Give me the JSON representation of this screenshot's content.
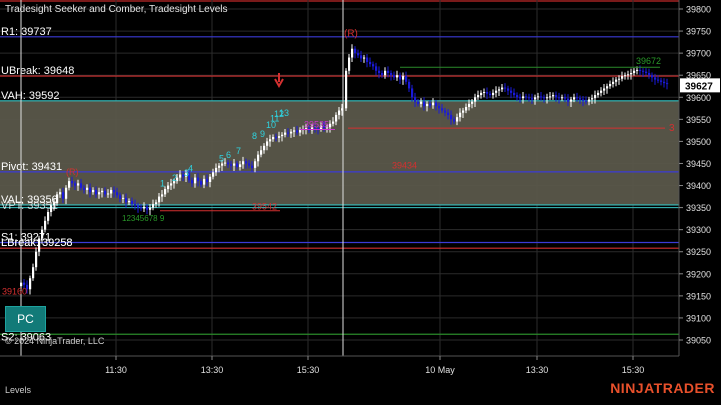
{
  "window": {
    "title": "Tradesight Seeker and Comber, Tradesight Levels",
    "copyright": "© 2024 NinjaTrader, LLC",
    "tab_label": "Levels",
    "brand": "NINJATRADER",
    "pc_button": "PC"
  },
  "price_axis": {
    "min": 39050,
    "max": 39800,
    "ticks": [
      39800,
      39750,
      39700,
      39650,
      39600,
      39550,
      39500,
      39450,
      39400,
      39350,
      39300,
      39250,
      39200,
      39150,
      39100,
      39050
    ],
    "current_price": 39627
  },
  "time_axis": {
    "labels": [
      {
        "label": "11:30"
      },
      {
        "label": "13:30"
      },
      {
        "label": "15:30"
      },
      {
        "label": "10 May"
      },
      {
        "label": "13:30"
      },
      {
        "label": "15:30"
      }
    ]
  },
  "levels": [
    {
      "label": "R1: 39737",
      "price": 39737,
      "color": "#3b3bd6"
    },
    {
      "label": "UBreak: 39648",
      "price": 39648,
      "color": "#d43030"
    },
    {
      "label": "VAH: 39592",
      "price": 39592,
      "color": "#36c0c0"
    },
    {
      "label": "Pivot: 39431",
      "price": 39431,
      "color": "#3b3bd6"
    },
    {
      "label": "VAL: 39356",
      "price": 39356,
      "color": "#36c0c0"
    },
    {
      "label": "S1: 39271",
      "price": 39271,
      "color": "#3b3bd6"
    },
    {
      "label": "LBreak: 39258",
      "price": 39258,
      "color": "#d43030"
    },
    {
      "label": "S2: 39063",
      "price": 39063,
      "color": "#2a8a2a"
    }
  ],
  "overlapping_labels": [
    "VPT: 39351",
    "LBreak: 39258",
    "S2: 39063"
  ],
  "annotations": [
    {
      "text": "39542",
      "color": "#d43030"
    },
    {
      "text": "39434",
      "color": "#d43030"
    },
    {
      "text": "39535",
      "color": "#cc33cc"
    },
    {
      "text": "39160",
      "color": "#d43030"
    },
    {
      "text": "39672",
      "color": "#2a9a2a"
    },
    {
      "text": "(R)",
      "color": "#d43030"
    },
    {
      "text": "(R)",
      "color": "#d43030"
    },
    {
      "text": "3",
      "color": "#d43030"
    }
  ],
  "seeker_counts": [
    "1",
    "2",
    "3",
    "4",
    "5",
    "6",
    "7",
    "8",
    "9",
    "10",
    "11",
    "12",
    "13"
  ],
  "comber_counts": "12345678 9",
  "colors": {
    "value_area": "#5a574a",
    "bar_up": "#ffffff",
    "bar_down": "#1a1adb",
    "session_line": "#e0e0e0",
    "grid": "#2b2b2b"
  }
}
